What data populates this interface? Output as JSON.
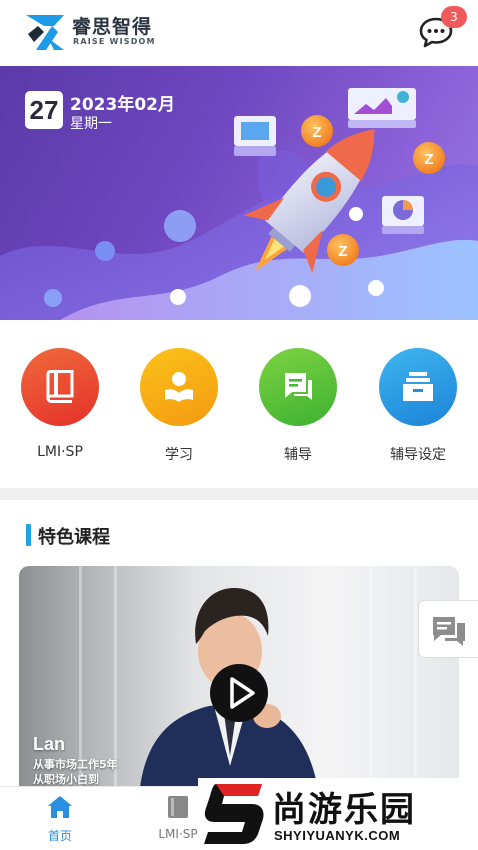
{
  "header": {
    "logo_cn": "睿思智得",
    "logo_en": "RAISE WISDOM",
    "message_badge": "3"
  },
  "banner": {
    "day": "27",
    "year_month": "2023年02月",
    "weekday": "星期一"
  },
  "menu": {
    "items": [
      {
        "label": "LMI·SP",
        "icon": "book-icon",
        "color": "#e94a2e"
      },
      {
        "label": "学习",
        "icon": "reading-person-icon",
        "color": "#f6ab14"
      },
      {
        "label": "辅导",
        "icon": "chat-document-icon",
        "color": "#55bf36"
      },
      {
        "label": "辅导设定",
        "icon": "inbox-tray-icon",
        "color": "#2196e3"
      }
    ]
  },
  "section": {
    "title": "特色课程",
    "accent_color": "#1fa3e8"
  },
  "course": {
    "name": "Lan",
    "desc_line1": "从事市场工作5年",
    "desc_line2": "从职场小白到"
  },
  "bottom_nav": {
    "items": [
      {
        "label": "首页",
        "icon": "home-icon",
        "active": true
      },
      {
        "label": "LMI·SP",
        "icon": "book-icon",
        "active": false
      }
    ],
    "active_color": "#2a8fe0"
  },
  "watermark": {
    "cn": "尚游乐园",
    "en": "SHYIYUANYK.COM"
  }
}
